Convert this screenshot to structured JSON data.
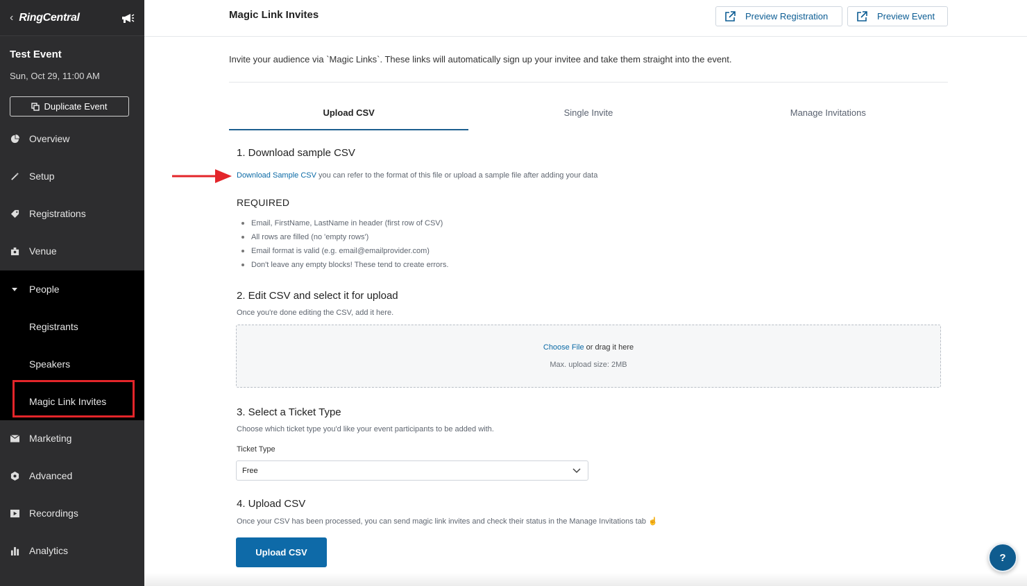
{
  "sidebar": {
    "brand": "RingCentral",
    "back_glyph": "‹",
    "event_title": "Test Event",
    "event_date": "Sun, Oct 29, 11:00 AM",
    "duplicate_label": "Duplicate Event",
    "items": [
      {
        "label": "Overview",
        "icon": "pie-chart-icon"
      },
      {
        "label": "Setup",
        "icon": "magic-wand-icon"
      },
      {
        "label": "Registrations",
        "icon": "tag-icon"
      },
      {
        "label": "Venue",
        "icon": "venue-icon"
      },
      {
        "label": "People",
        "icon": "caret-down-icon"
      },
      {
        "label": "Marketing",
        "icon": "envelope-icon"
      },
      {
        "label": "Advanced",
        "icon": "hexagon-icon"
      },
      {
        "label": "Recordings",
        "icon": "play-icon"
      },
      {
        "label": "Analytics",
        "icon": "bar-chart-icon"
      }
    ],
    "people_sub": [
      "Registrants",
      "Speakers",
      "Magic Link Invites"
    ],
    "highlight_color": "#e3252a"
  },
  "header": {
    "title": "Magic Link Invites",
    "preview_registration": "Preview Registration",
    "preview_event": "Preview Event"
  },
  "intro": "Invite your audience via `Magic Links`. These links will automatically sign up your invitee and take them straight into the event.",
  "tabs": [
    {
      "label": "Upload CSV",
      "active": true
    },
    {
      "label": "Single Invite",
      "active": false
    },
    {
      "label": "Manage Invitations",
      "active": false
    }
  ],
  "step1": {
    "title": "1. Download sample CSV",
    "link": "Download Sample CSV",
    "desc": " you can refer to the format of this file or upload a sample file after adding your data",
    "required_title": "REQUIRED",
    "required": [
      "Email, FirstName, LastName in header (first row of CSV)",
      "All rows are filled (no 'empty rows')",
      "Email format is valid (e.g. email@emailprovider.com)",
      "Don't leave any empty blocks! These tend to create errors."
    ]
  },
  "step2": {
    "title": "2. Edit CSV and select it for upload",
    "desc": "Once you're done editing the CSV, add it here.",
    "choose_file": "Choose File",
    "drag_text": " or drag it here",
    "max_size": "Max. upload size: 2MB"
  },
  "step3": {
    "title": "3. Select a Ticket Type",
    "desc": "Choose which ticket type you'd like your event participants to be added with.",
    "field_label": "Ticket Type",
    "selected": "Free"
  },
  "step4": {
    "title": "4. Upload CSV",
    "desc": "Once your CSV has been processed, you can send magic link invites and check their status in the Manage Invitations tab ☝️",
    "button": "Upload CSV"
  },
  "help": "?",
  "colors": {
    "accent": "#0e6aa8",
    "link": "#0b6aa6",
    "annotation": "#e3252a"
  }
}
